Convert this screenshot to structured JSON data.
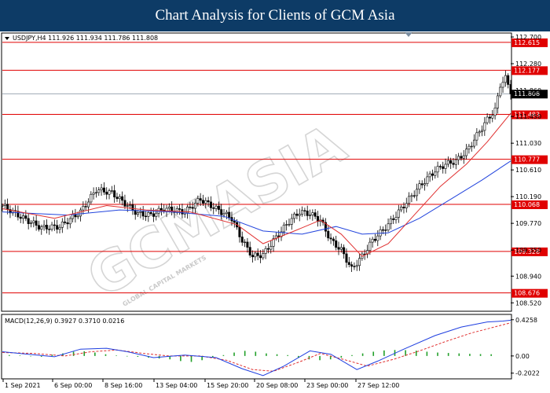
{
  "header": {
    "title": "Chart Analysis for Clients of GCM Asia"
  },
  "watermark": {
    "text": "GCMASIA",
    "subtext": "GLOBAL CAPITAL MARKETS"
  },
  "colors": {
    "banner": "#0d3b66",
    "level": "#e00000",
    "ma_fast": "#e03030",
    "ma_slow": "#2244dd",
    "macd_line": "#1e3ee0",
    "signal_line": "#e03030",
    "histogram": "#22a02a",
    "current": "#000000"
  },
  "chart_data": [
    {
      "type": "candlestick",
      "info_text": "USDJPY,H4  111.926 111.934 111.786 111.808",
      "ylim": [
        108.4,
        112.75
      ],
      "y_ticks": [
        "112.700",
        "112.280",
        "111.860",
        "111.450",
        "111.030",
        "110.610",
        "110.190",
        "109.770",
        "109.350",
        "108.940",
        "108.520"
      ],
      "x_ticks": [
        "1 Sep 2021",
        "6 Sep 00:00",
        "8 Sep 16:00",
        "13 Sep 04:00",
        "15 Sep 20:00",
        "20 Sep 08:00",
        "23 Sep 00:00",
        "27 Sep 12:00"
      ],
      "levels": [
        {
          "label": "112.615",
          "value": 112.615
        },
        {
          "label": "112.177",
          "value": 112.177
        },
        {
          "label": "111.483",
          "value": 111.483
        },
        {
          "label": "110.777",
          "value": 110.777
        },
        {
          "label": "110.068",
          "value": 110.068
        },
        {
          "label": "109.328",
          "value": 109.328
        },
        {
          "label": "108.676",
          "value": 108.676
        }
      ],
      "current_price": {
        "label": "111.808",
        "value": 111.808
      },
      "close_path": [
        [
          0,
          110.05
        ],
        [
          8,
          109.85
        ],
        [
          15,
          109.7
        ],
        [
          22,
          109.72
        ],
        [
          30,
          109.95
        ],
        [
          36,
          110.3
        ],
        [
          42,
          110.25
        ],
        [
          48,
          110.05
        ],
        [
          52,
          109.92
        ],
        [
          57,
          109.9
        ],
        [
          62,
          110.0
        ],
        [
          70,
          109.95
        ],
        [
          76,
          110.15
        ],
        [
          82,
          110.0
        ],
        [
          88,
          109.85
        ],
        [
          92,
          109.5
        ],
        [
          96,
          109.25
        ],
        [
          100,
          109.28
        ],
        [
          105,
          109.55
        ],
        [
          110,
          109.8
        ],
        [
          114,
          109.95
        ],
        [
          118,
          109.92
        ],
        [
          122,
          109.82
        ],
        [
          126,
          109.5
        ],
        [
          130,
          109.35
        ],
        [
          134,
          109.05
        ],
        [
          138,
          109.25
        ],
        [
          142,
          109.5
        ],
        [
          148,
          109.75
        ],
        [
          154,
          110.05
        ],
        [
          160,
          110.35
        ],
        [
          166,
          110.6
        ],
        [
          170,
          110.7
        ],
        [
          174,
          110.75
        ],
        [
          178,
          110.9
        ],
        [
          182,
          111.15
        ],
        [
          186,
          111.4
        ],
        [
          189,
          111.55
        ],
        [
          191,
          111.95
        ],
        [
          193,
          112.05
        ],
        [
          195,
          111.85
        ]
      ],
      "ma_fast": [
        [
          0,
          110.0
        ],
        [
          20,
          109.85
        ],
        [
          40,
          110.05
        ],
        [
          55,
          109.98
        ],
        [
          72,
          109.95
        ],
        [
          90,
          109.75
        ],
        [
          100,
          109.45
        ],
        [
          112,
          109.65
        ],
        [
          122,
          109.82
        ],
        [
          130,
          109.6
        ],
        [
          138,
          109.25
        ],
        [
          148,
          109.45
        ],
        [
          158,
          109.9
        ],
        [
          168,
          110.35
        ],
        [
          178,
          110.7
        ],
        [
          186,
          111.05
        ],
        [
          195,
          111.5
        ]
      ],
      "ma_slow": [
        [
          0,
          109.95
        ],
        [
          25,
          109.9
        ],
        [
          45,
          109.98
        ],
        [
          65,
          109.95
        ],
        [
          85,
          109.88
        ],
        [
          100,
          109.65
        ],
        [
          115,
          109.6
        ],
        [
          128,
          109.72
        ],
        [
          138,
          109.6
        ],
        [
          148,
          109.62
        ],
        [
          160,
          109.85
        ],
        [
          172,
          110.15
        ],
        [
          184,
          110.45
        ],
        [
          195,
          110.75
        ]
      ]
    },
    {
      "type": "line",
      "info_text": "MACD(12,26,9)  0.3927 0.3710 0.0216",
      "ylim": [
        -0.26,
        0.47
      ],
      "y_ticks": [
        "0.4258",
        "0.00",
        "-0.2022"
      ],
      "series": [
        {
          "values": [
            [
              0,
              0.05
            ],
            [
              10,
              0.02
            ],
            [
              20,
              -0.01
            ],
            [
              30,
              0.08
            ],
            [
              40,
              0.09
            ],
            [
              48,
              0.05
            ],
            [
              58,
              -0.02
            ],
            [
              70,
              0.01
            ],
            [
              82,
              -0.02
            ],
            [
              92,
              -0.15
            ],
            [
              100,
              -0.23
            ],
            [
              108,
              -0.12
            ],
            [
              118,
              0.06
            ],
            [
              126,
              0.02
            ],
            [
              136,
              -0.16
            ],
            [
              144,
              -0.06
            ],
            [
              154,
              0.08
            ],
            [
              166,
              0.24
            ],
            [
              176,
              0.34
            ],
            [
              186,
              0.4
            ],
            [
              192,
              0.41
            ],
            [
              195,
              0.42
            ]
          ]
        },
        {
          "values": [
            [
              0,
              0.04
            ],
            [
              12,
              0.03
            ],
            [
              24,
              0.0
            ],
            [
              34,
              0.05
            ],
            [
              44,
              0.07
            ],
            [
              54,
              0.03
            ],
            [
              64,
              0.0
            ],
            [
              76,
              0.0
            ],
            [
              86,
              -0.05
            ],
            [
              96,
              -0.16
            ],
            [
              104,
              -0.18
            ],
            [
              114,
              -0.07
            ],
            [
              122,
              0.03
            ],
            [
              132,
              -0.05
            ],
            [
              140,
              -0.12
            ],
            [
              150,
              -0.04
            ],
            [
              160,
              0.06
            ],
            [
              170,
              0.17
            ],
            [
              180,
              0.27
            ],
            [
              190,
              0.35
            ],
            [
              195,
              0.39
            ]
          ]
        }
      ],
      "histogram": [
        0.01,
        0.005,
        -0.005,
        -0.01,
        0.015,
        0.03,
        0.05,
        0.055,
        0.04,
        0.02,
        0.005,
        -0.005,
        -0.01,
        -0.02,
        -0.03,
        -0.04,
        -0.06,
        -0.07,
        -0.05,
        -0.02,
        0.01,
        0.04,
        0.06,
        0.05,
        0.03,
        0.02,
        0.01,
        -0.02,
        -0.04,
        -0.05,
        -0.04,
        -0.02,
        0.01,
        0.03,
        0.05,
        0.065,
        0.07,
        0.068,
        0.062,
        0.05,
        0.04,
        0.035,
        0.03,
        0.025,
        0.022,
        0.02
      ]
    }
  ]
}
